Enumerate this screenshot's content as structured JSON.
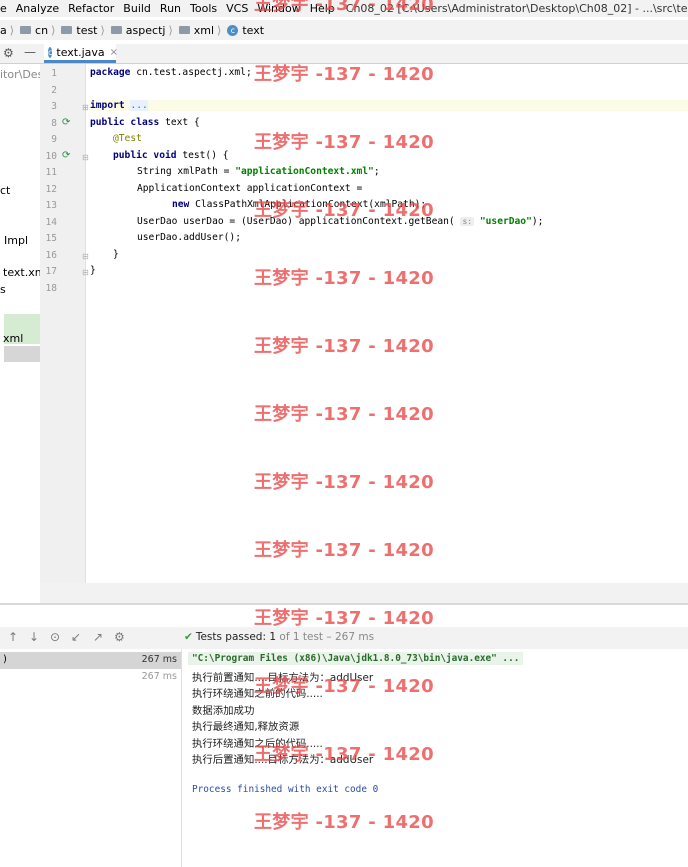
{
  "menubar": {
    "items": [
      "e",
      "Analyze",
      "Refactor",
      "Build",
      "Run",
      "Tools",
      "VCS",
      "Window",
      "Help"
    ],
    "window_title": "Ch08_02 [C:\\Users\\Administrator\\Desktop\\Ch08_02] - ...\\src\\test\\java\\cn\\te"
  },
  "navbar": {
    "crumbs": [
      "a",
      "cn",
      "test",
      "aspectj",
      "xml",
      "text"
    ]
  },
  "tab": {
    "name": "text.java"
  },
  "project_panel": {
    "lines": [
      "itor\\Des",
      "ct",
      "Impl",
      "text.xm",
      "s",
      "xml"
    ]
  },
  "editor": {
    "line_numbers": [
      "1",
      "2",
      "3",
      "8",
      "9",
      "10",
      "11",
      "12",
      "13",
      "14",
      "15",
      "16",
      "17",
      "18"
    ],
    "lines": [
      "package cn.test.aspectj.xml;",
      "",
      "import ...",
      "public class text {",
      "@Test",
      "public void test() {",
      "String xmlPath = \"applicationContext.xml\";",
      "ApplicationContext applicationContext =",
      "new ClassPathXmlApplicationContext(xmlPath);",
      "UserDao userDao = (UserDao) applicationContext.getBean( s: \"userDao\");",
      "userDao.addUser();",
      "}",
      "}",
      ""
    ],
    "hint_label": "s:"
  },
  "run": {
    "tests_passed_label": "Tests passed:",
    "tests_passed_count": "1",
    "tests_passed_detail": "of 1 test – 267 ms",
    "tree": [
      {
        "label": ")",
        "time": "267 ms"
      },
      {
        "label": "",
        "time": "267 ms"
      }
    ],
    "console": {
      "command": "\"C:\\Program Files (x86)\\Java\\jdk1.8.0_73\\bin\\java.exe\" ...",
      "output": [
        "执行前置通知....目标方法为：addUser",
        "执行环绕通知之前的代码.....",
        "数据添加成功",
        "执行最终通知,释放资源",
        "执行环绕通知之后的代码.....",
        "执行后置通知....目标方法为：addUser"
      ],
      "exit": "Process finished with exit code 0"
    }
  },
  "watermark": {
    "text": "王梦宇 -137 - 1420"
  }
}
